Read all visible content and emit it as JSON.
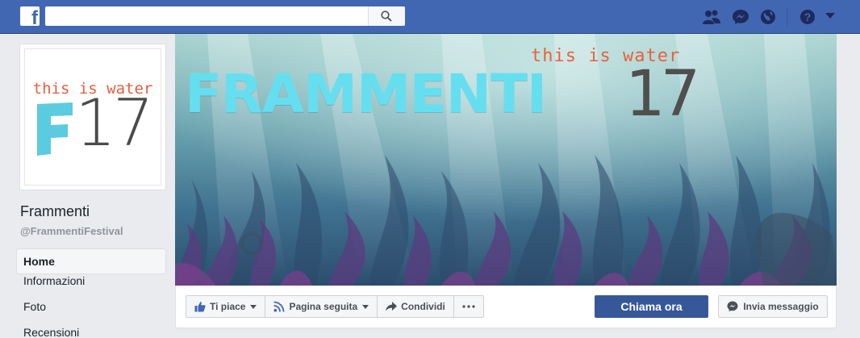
{
  "topbar": {
    "logo_letter": "f",
    "search_placeholder": "",
    "icons": [
      "facebook-logo-icon",
      "search-icon",
      "friend-requests-icon",
      "messenger-icon",
      "notifications-globe-icon",
      "help-icon",
      "account-menu-caret-icon"
    ]
  },
  "profile_picture": {
    "tagline": "this is water",
    "number": "17",
    "colors": {
      "tagline": "#e85d3f",
      "f_block": "#5bcbe0",
      "number": "#4b4b4b"
    }
  },
  "page": {
    "name": "Frammenti",
    "handle": "@FrammentiFestival"
  },
  "nav": {
    "items": [
      "Home",
      "Informazioni",
      "Foto",
      "Recensioni"
    ],
    "active": "Home"
  },
  "cover": {
    "tagline": "this is water",
    "title": "FRAMMENTI",
    "number": "17",
    "colors": {
      "tagline": "#e8623d",
      "title": "#65dff0",
      "number": "#4f4f4f",
      "water_top": "#a8d4d0",
      "water_bottom": "#2f5d78",
      "seaweed": "#6b3f85"
    }
  },
  "actions": {
    "like": "Ti piace",
    "follow": "Pagina seguita",
    "share": "Condividi",
    "more": "...",
    "call": "Chiama ora",
    "message": "Invia messaggio"
  },
  "colors": {
    "brand_blue": "#4267b2",
    "primary_button": "#365899",
    "page_bg": "#e9ebee"
  }
}
